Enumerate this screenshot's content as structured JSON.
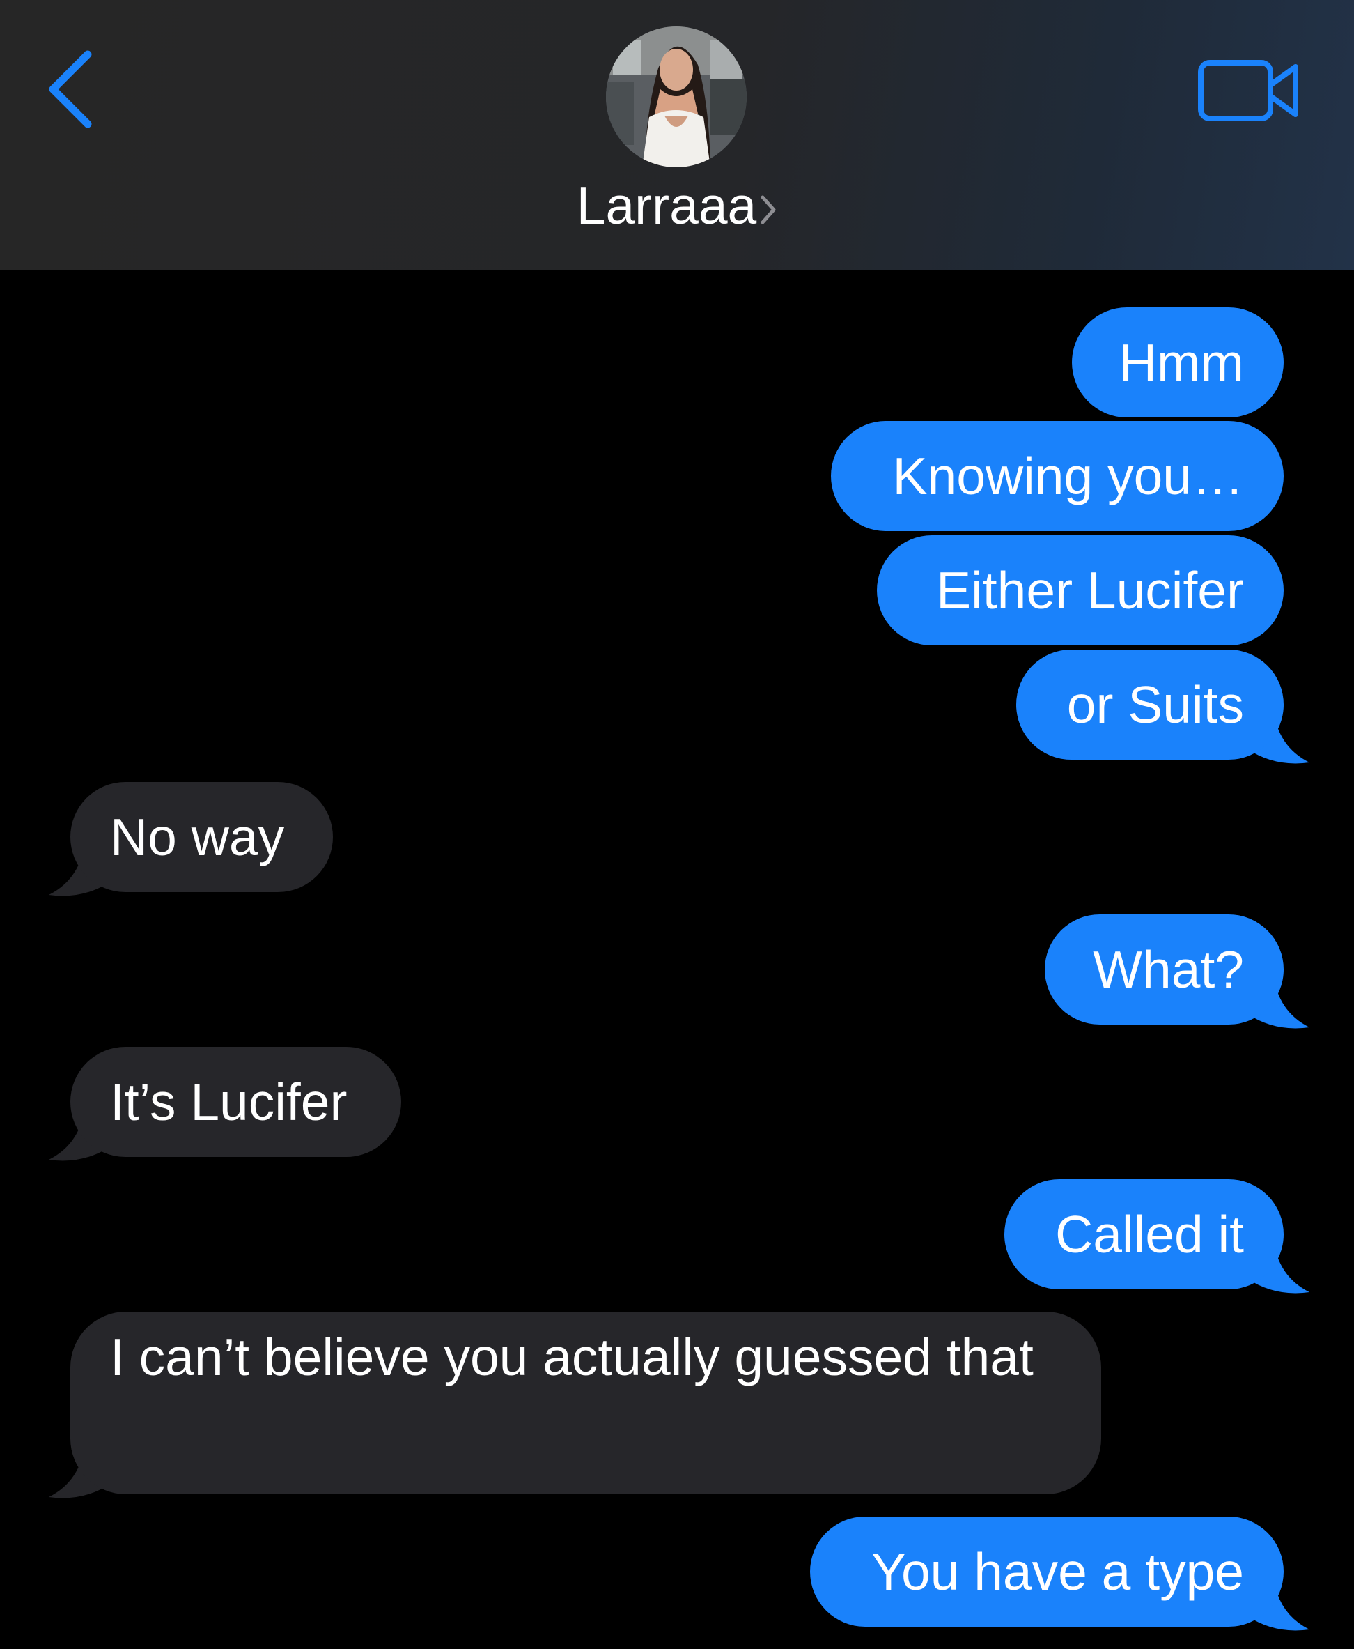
{
  "header": {
    "back_icon": "chevron-left-icon",
    "contact_name": "Larraaa",
    "name_chevron_icon": "chevron-right-icon",
    "video_icon": "video-camera-icon",
    "avatar": "contact-photo",
    "accent_color": "#1a82fb"
  },
  "colors": {
    "sent_bubble": "#1a82fb",
    "received_bubble": "#26262a",
    "background": "#000000"
  },
  "messages": [
    {
      "direction": "sent",
      "text": "Hmm"
    },
    {
      "direction": "sent",
      "text": "Knowing you…"
    },
    {
      "direction": "sent",
      "text": "Either Lucifer"
    },
    {
      "direction": "sent",
      "text": "or Suits"
    },
    {
      "direction": "received",
      "text": "No way"
    },
    {
      "direction": "sent",
      "text": "What?"
    },
    {
      "direction": "received",
      "text": "It’s Lucifer"
    },
    {
      "direction": "sent",
      "text": "Called it"
    },
    {
      "direction": "received",
      "text": "I can’t believe you actually guessed that"
    },
    {
      "direction": "sent",
      "text": "You have a type"
    }
  ]
}
